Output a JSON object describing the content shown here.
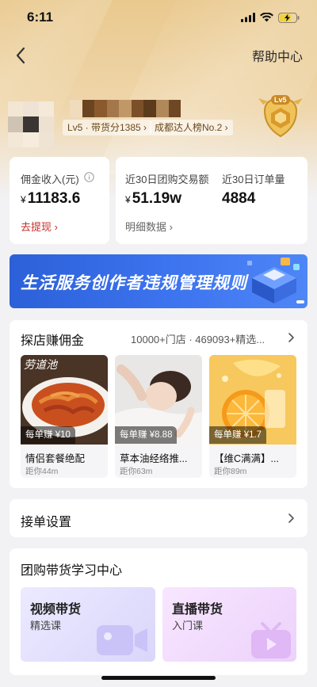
{
  "status_bar": {
    "time": "6:11"
  },
  "nav": {
    "help_label": "帮助中心"
  },
  "profile": {
    "level_tag": "Lv5 · 带货分1385 ›",
    "rank_tag": "成都达人榜No.2 ›",
    "badge_text": "Lv5"
  },
  "stats": {
    "commission": {
      "label": "佣金收入(元)",
      "currency": "¥",
      "value": "11183.6",
      "link": "去提现 ›"
    },
    "gmv_30d": {
      "label": "近30日团购交易额",
      "currency": "¥",
      "value": "51.19w",
      "link": "明细数据 ›"
    },
    "orders_30d": {
      "label": "近30日订单量",
      "value": "4884"
    }
  },
  "banner": {
    "text": "生活服务创作者违规管理规则"
  },
  "explore": {
    "title": "探店赚佣金",
    "summary": "10000+门店 · 469093+精选...",
    "shops": [
      {
        "price": "每单赚 ¥10",
        "name": "情侣套餐绝配",
        "distance": "距你44m",
        "sign_text": "劳道池"
      },
      {
        "price": "每单赚 ¥8.88",
        "name": "草本油经络推...",
        "distance": "距你63m"
      },
      {
        "price": "每单赚 ¥1.7",
        "name": "【维C满满】...",
        "distance": "距你89m"
      }
    ]
  },
  "order_settings": {
    "label": "接单设置"
  },
  "learning": {
    "title": "团购带货学习中心",
    "courses": [
      {
        "title": "视频带货",
        "subtitle": "精选课"
      },
      {
        "title": "直播带货",
        "subtitle": "入门课"
      }
    ]
  },
  "colors": {
    "link_red": "#c4302b",
    "link_gray": "#666666",
    "banner_blue": "#2f67e0",
    "hero_gold": "#e9c98e"
  }
}
